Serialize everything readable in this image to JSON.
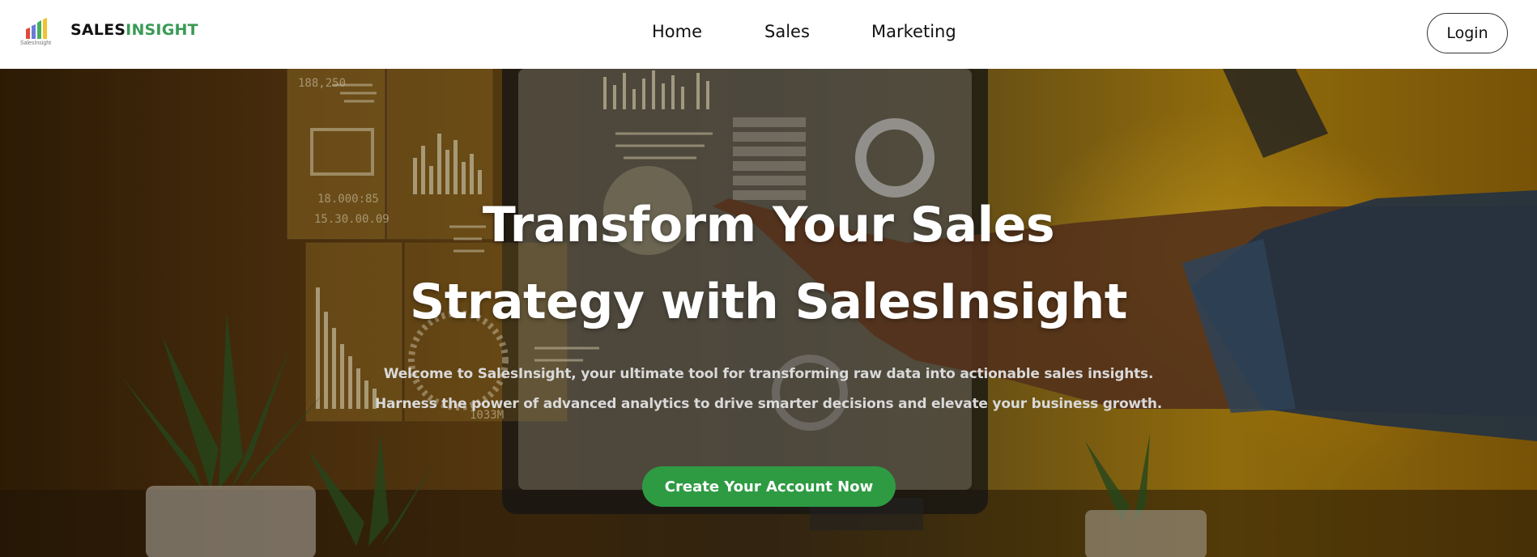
{
  "header": {
    "logo_caption": "SalesInsight",
    "brand_part1": "SALES",
    "brand_part2": "INSIGHT",
    "nav": [
      {
        "label": "Home"
      },
      {
        "label": "Sales"
      },
      {
        "label": "Marketing"
      }
    ],
    "login_label": "Login"
  },
  "hero": {
    "headline_line1": "Transform Your Sales",
    "headline_line2": "Strategy with SalesInsight",
    "subtext_line1": "Welcome to SalesInsight, your ultimate tool for transforming raw data into actionable sales insights.",
    "subtext_line2": "Harness the power of advanced analytics to drive smarter decisions and elevate your business growth.",
    "cta_label": "Create Your Account Now",
    "screen_readouts": [
      "188,250",
      "18.000:85",
      "15.30.00.09",
      "1033M"
    ]
  },
  "colors": {
    "brand_dark": "#111111",
    "brand_green": "#3a9a55",
    "cta_green": "#2e9b43",
    "hero_amber": "#b98a10"
  }
}
